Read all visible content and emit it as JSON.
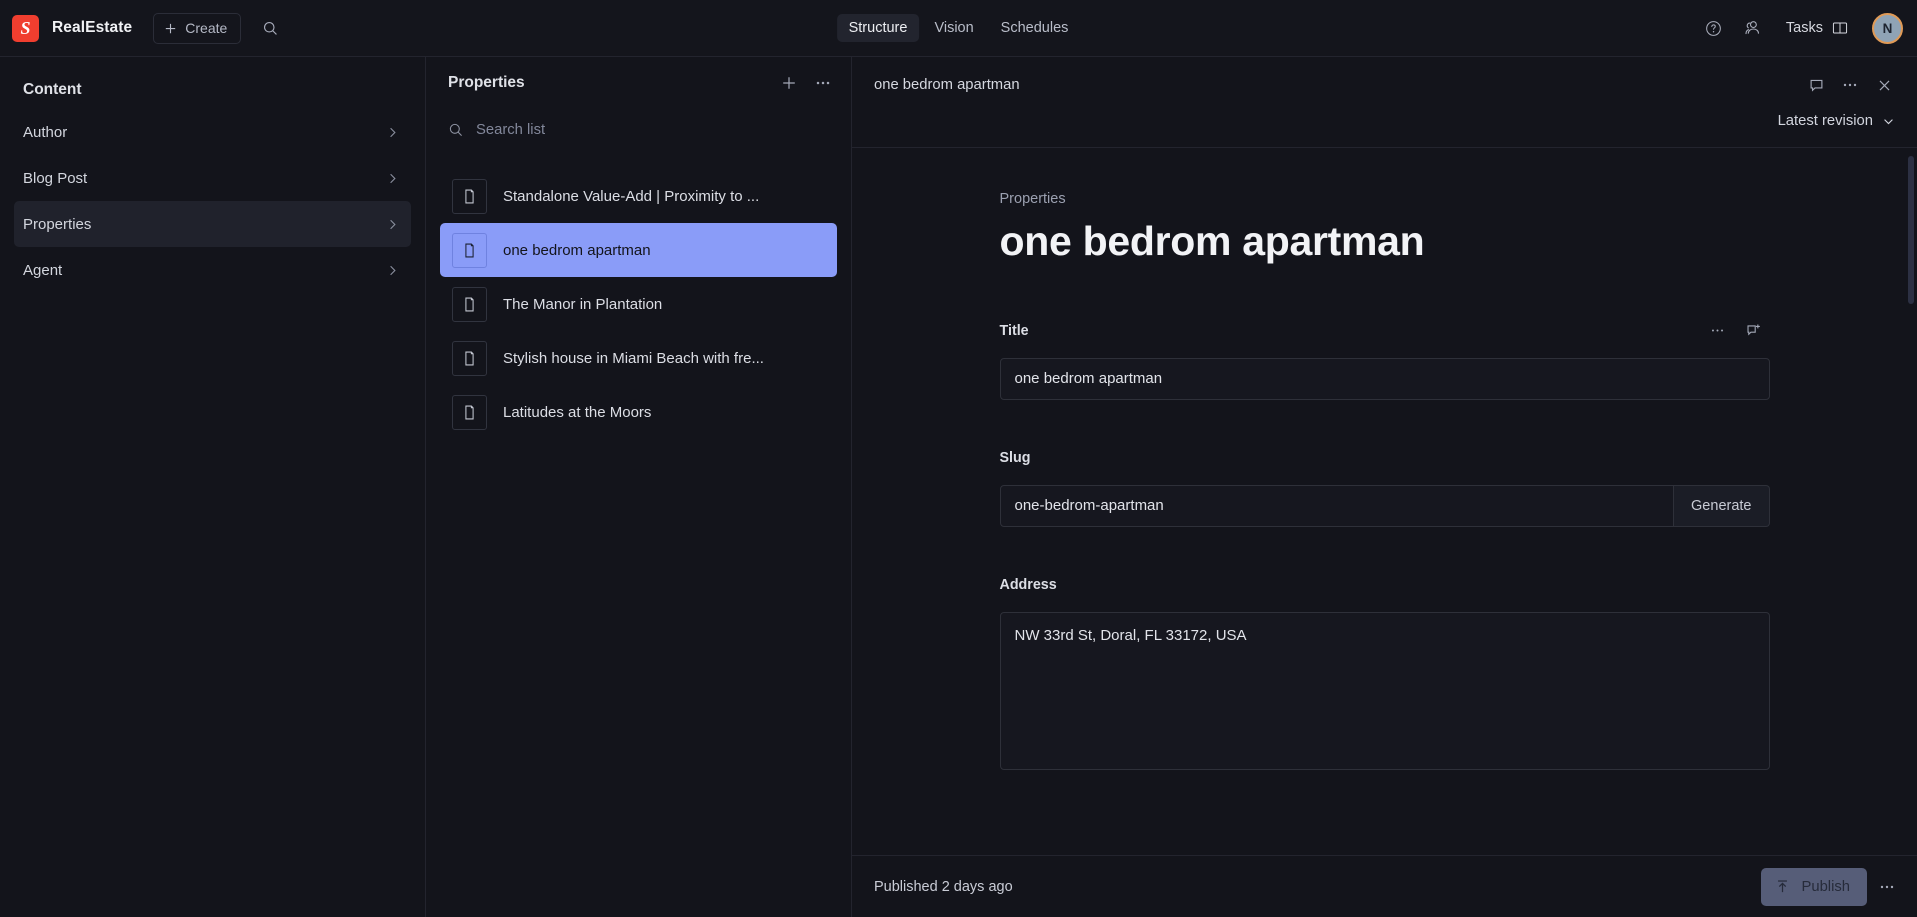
{
  "navbar": {
    "logo_letter": "S",
    "brand": "RealEstate",
    "create_label": "Create",
    "search_icon": "search-icon",
    "tabs": [
      {
        "label": "Structure",
        "active": true
      },
      {
        "label": "Vision",
        "active": false
      },
      {
        "label": "Schedules",
        "active": false
      }
    ],
    "help_icon": "question-circle-icon",
    "members_icon": "people-icon",
    "tasks_label": "Tasks",
    "tasks_panel_icon": "panel-icon",
    "avatar_initial": "N",
    "avatar_ring_color": "#e09a56",
    "avatar_bg_color": "#8fa3b5"
  },
  "structure_pane": {
    "title": "Content",
    "items": [
      {
        "label": "Author",
        "active": false,
        "has_chevron": true
      },
      {
        "label": "Blog Post",
        "active": false,
        "has_chevron": true
      },
      {
        "label": "Properties",
        "active": true,
        "has_chevron": true
      },
      {
        "label": "Agent",
        "active": false,
        "has_chevron": true
      }
    ]
  },
  "list_pane": {
    "title": "Properties",
    "add_label": "add-icon",
    "more_label": "more-icon",
    "search_placeholder": "Search list",
    "search_value": "",
    "documents": [
      {
        "label": "Standalone Value-Add | Proximity to ...",
        "selected": false
      },
      {
        "label": "one bedrom apartman",
        "selected": true
      },
      {
        "label": "The Manor in Plantation",
        "selected": false
      },
      {
        "label": "Stylish house in Miami Beach with fre...",
        "selected": false
      },
      {
        "label": "Latitudes at the Moors",
        "selected": false
      }
    ],
    "selected_color": "#8a9cf8"
  },
  "document_pane": {
    "header_title": "one bedrom apartman",
    "comment_icon": "comment-icon",
    "more_icon": "more-icon",
    "close_icon": "close-icon",
    "revision_label": "Latest revision",
    "eyebrow": "Properties",
    "title": "one bedrom apartman",
    "fields": [
      {
        "label": "Title",
        "type": "text",
        "value": "one bedrom apartman",
        "has_actions": true
      },
      {
        "label": "Slug",
        "type": "slug",
        "value": "one-bedrom-apartman",
        "button_label": "Generate",
        "has_actions": false
      },
      {
        "label": "Address",
        "type": "textarea",
        "value": "NW 33rd St, Doral, FL 33172, USA",
        "has_actions": false
      }
    ],
    "footer": {
      "status": "Published 2 days ago",
      "publish_label": "Publish",
      "publish_icon": "publish-arrow-icon",
      "more_icon": "more-icon"
    }
  }
}
